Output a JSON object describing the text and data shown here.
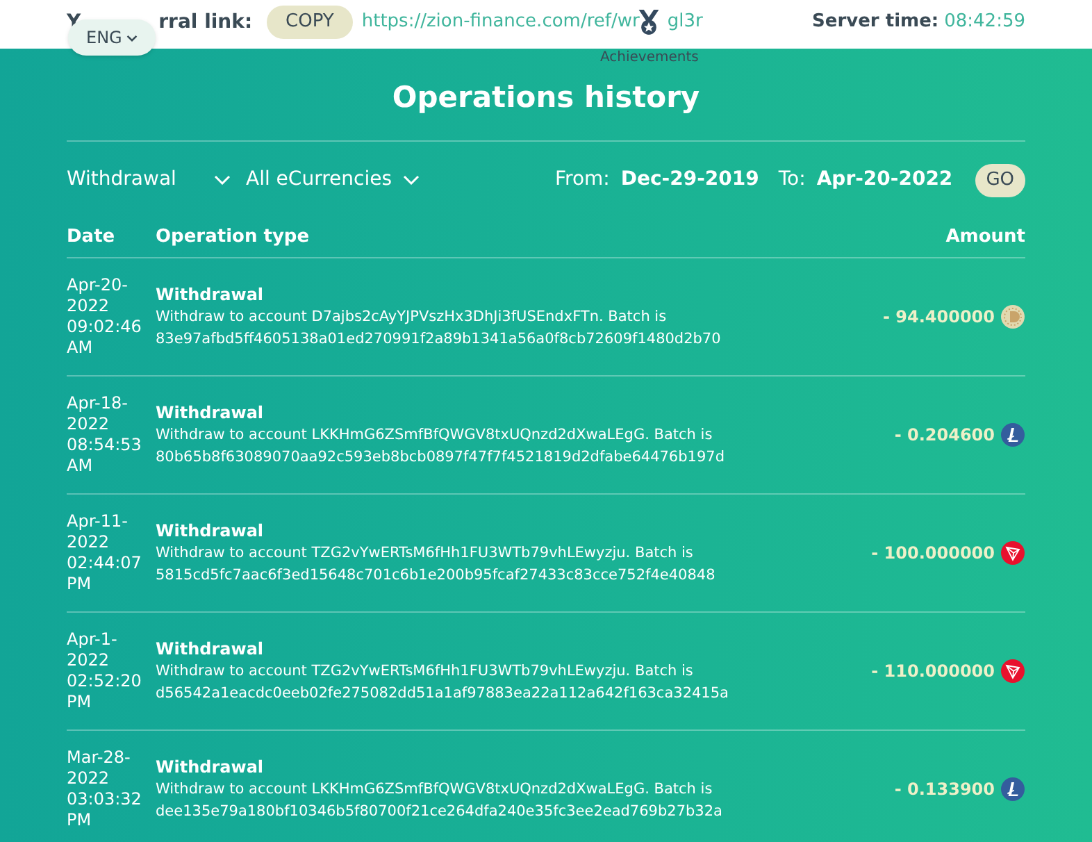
{
  "top_bar": {
    "referral_label_parts": [
      "Y",
      "rral link:"
    ],
    "copy_button": "COPY",
    "link_parts": [
      "https://zion-finance.com/ref/wr",
      "gl3r"
    ],
    "achievements_label": "Achievements",
    "language_button": "ENG",
    "server_time_label": "Server time:",
    "server_time": "08:42:59"
  },
  "title": "Operations history",
  "filters": {
    "operation": "Withdrawal",
    "currency": "All eCurrencies",
    "from_label": "From:",
    "from": "Dec-29-2019",
    "to_label": "To:",
    "to": "Apr-20-2022",
    "go_button": "GO"
  },
  "table": {
    "columns": [
      "Date",
      "Operation type",
      "Amount"
    ],
    "rows": [
      {
        "date": "Apr-20-2022 09:02:46 AM",
        "type": "Withdrawal",
        "details": "Withdraw to account D7ajbs2cAyYJPVszHx3DhJi3fUSEndxFTn. Batch is 83e97afbd5ff4605138a01ed270991f2a89b1341a56a0f8cb72609f1480d2b70",
        "amount": "- 94.400000",
        "kind": "doge"
      },
      {
        "date": "Apr-18-2022 08:54:53 AM",
        "type": "Withdrawal",
        "details": "Withdraw to account LKKHmG6ZSmfBfQWGV8txUQnzd2dXwaLEgG. Batch is 80b65b8f63089070aa92c593eb8bcb0897f47f7f4521819d2dfabe64476b197d",
        "amount": "- 0.204600",
        "kind": "litecoin"
      },
      {
        "date": "Apr-11-2022 02:44:07 PM",
        "type": "Withdrawal",
        "details": "Withdraw to account TZG2vYwERTsM6fHh1FU3WTb79vhLEwyzju. Batch is 5815cd5fc7aac6f3ed15648c701c6b1e200b95fcaf27433c83cce752f4e40848",
        "amount": "- 100.000000",
        "kind": "tron"
      },
      {
        "date": "Apr-1-2022 02:52:20 PM",
        "type": "Withdrawal",
        "details": "Withdraw to account TZG2vYwERTsM6fHh1FU3WTb79vhLEwyzju. Batch is d56542a1eacdc0eeb02fe275082dd51a1af97883ea22a112a642f163ca32415a",
        "amount": "- 110.000000",
        "kind": "tron"
      },
      {
        "date": "Mar-28-2022 03:03:32 PM",
        "type": "Withdrawal",
        "details": "Withdraw to account LKKHmG6ZSmfBfQWGV8txUQnzd2dXwaLEgG. Batch is dee135e79a180bf10346b5f80700f21ce264dfa240e35fc3ee2ead769b27b32a",
        "amount": "- 0.133900",
        "kind": "litecoin"
      }
    ]
  }
}
